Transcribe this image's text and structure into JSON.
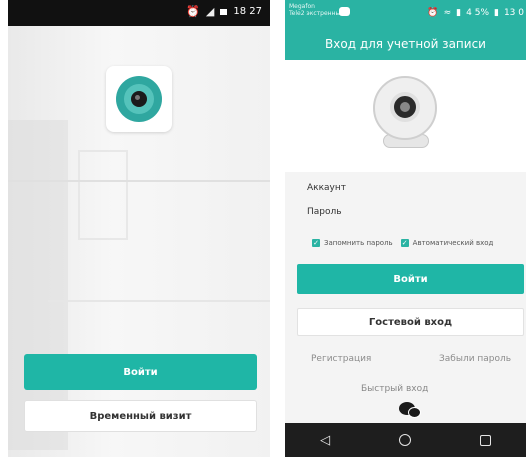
{
  "left_screen": {
    "status_time": "18 27",
    "primary_button": "Войти",
    "secondary_button": "Временный визит"
  },
  "right_screen": {
    "status": {
      "carrier_lines": [
        "Megafon",
        "Tele2 экстренные"
      ],
      "battery": "4 5%",
      "time": "13 0"
    },
    "header_title": "Вход для учетной записи",
    "fields": [
      {
        "label": "Аккаунт",
        "value": ""
      },
      {
        "label": "Пароль",
        "value": ""
      }
    ],
    "checkboxes": [
      {
        "label": "Запомнить пароль",
        "checked": true
      },
      {
        "label": "Автоматический вход",
        "checked": true
      }
    ],
    "login_button": "Войти",
    "guest_button": "Гостевой вход",
    "register_link": "Регистрация",
    "forgot_link": "Забыли пароль",
    "quick_login": "Быстрый вход",
    "nav": {
      "back": "back-icon",
      "home": "home-icon",
      "recents": "recents-icon"
    }
  },
  "colors": {
    "accent": "#1fb6a6",
    "header": "#2ab3a3"
  }
}
